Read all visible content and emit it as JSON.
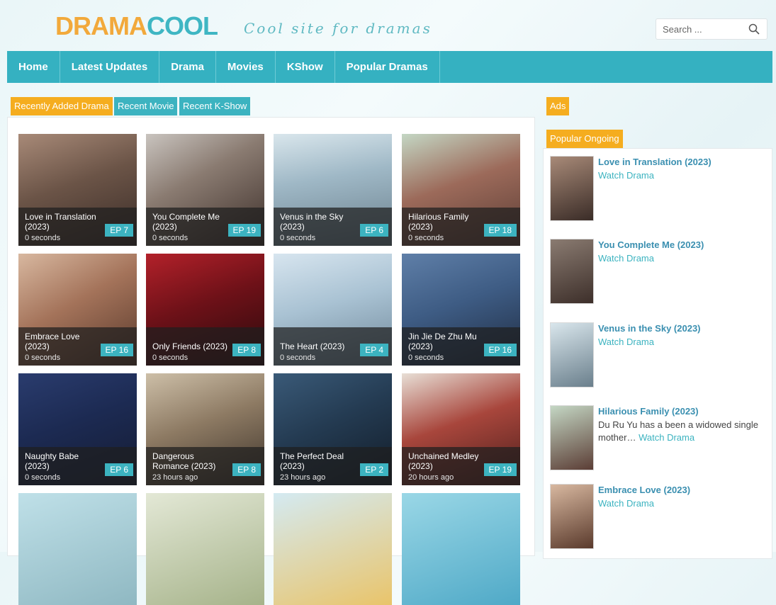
{
  "header": {
    "logo_part1": "DRAMA",
    "logo_part2": "COOL",
    "tagline": "Cool site for dramas",
    "search_placeholder": "Search ..."
  },
  "nav": [
    "Home",
    "Latest Updates",
    "Drama",
    "Movies",
    "KShow",
    "Popular Dramas"
  ],
  "tabs": [
    "Recently Added Drama",
    "Recent Movie",
    "Recent K-Show"
  ],
  "ads_label": "Ads",
  "popular_label": "Popular Ongoing",
  "cards": [
    {
      "title": "Love in Translation (2023)",
      "time": "0 seconds",
      "ep": "EP 7"
    },
    {
      "title": "You Complete Me (2023)",
      "time": "0 seconds",
      "ep": "EP 19"
    },
    {
      "title": "Venus in the Sky (2023)",
      "time": "0 seconds",
      "ep": "EP 6"
    },
    {
      "title": "Hilarious Family (2023)",
      "time": "0 seconds",
      "ep": "EP 18"
    },
    {
      "title": "Embrace Love (2023)",
      "time": "0 seconds",
      "ep": "EP 16"
    },
    {
      "title": "Only Friends (2023)",
      "time": "0 seconds",
      "ep": "EP 8"
    },
    {
      "title": "The Heart (2023)",
      "time": "0 seconds",
      "ep": "EP 4"
    },
    {
      "title": "Jin Jie De Zhu Mu (2023)",
      "time": "0 seconds",
      "ep": "EP 16"
    },
    {
      "title": "Naughty Babe (2023)",
      "time": "0 seconds",
      "ep": "EP 6"
    },
    {
      "title": "Dangerous Romance (2023)",
      "time": "23 hours ago",
      "ep": "EP 8"
    },
    {
      "title": "The Perfect Deal (2023)",
      "time": "23 hours ago",
      "ep": "EP 2"
    },
    {
      "title": "Unchained Medley (2023)",
      "time": "20 hours ago",
      "ep": "EP 19"
    },
    {
      "title": "",
      "time": "",
      "ep": ""
    },
    {
      "title": "",
      "time": "",
      "ep": ""
    },
    {
      "title": "",
      "time": "",
      "ep": ""
    },
    {
      "title": "",
      "time": "",
      "ep": ""
    }
  ],
  "popular": [
    {
      "title": "Love in Translation (2023)",
      "desc": "",
      "link": "Watch Drama"
    },
    {
      "title": "You Complete Me (2023)",
      "desc": "",
      "link": "Watch Drama"
    },
    {
      "title": "Venus in the Sky (2023)",
      "desc": "",
      "link": "Watch Drama"
    },
    {
      "title": "Hilarious Family (2023)",
      "desc": "Du Ru Yu has a been a widowed single mother…",
      "link": "Watch Drama"
    },
    {
      "title": "Embrace Love (2023)",
      "desc": "",
      "link": "Watch Drama"
    }
  ],
  "colors": {
    "accent": "#35b1c1",
    "orange": "#f5ad1f",
    "link": "#3a8fb0"
  }
}
